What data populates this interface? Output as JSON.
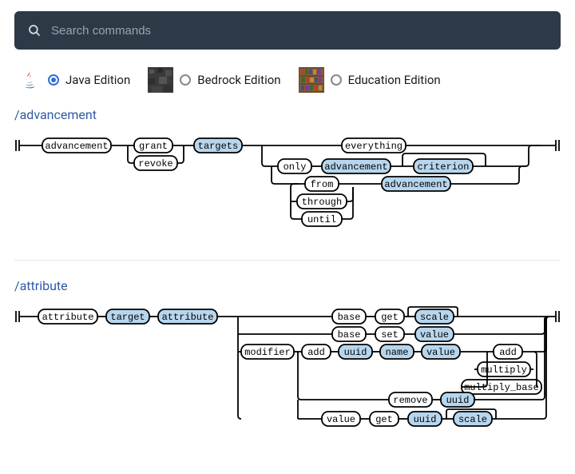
{
  "search": {
    "placeholder": "Search commands"
  },
  "editions": {
    "java": {
      "label": "Java Edition",
      "selected": true
    },
    "bedrock": {
      "label": "Bedrock Edition",
      "selected": false
    },
    "education": {
      "label": "Education Edition",
      "selected": false
    }
  },
  "sections": {
    "advancement": {
      "title": "/advancement",
      "nodes": {
        "advancement": "advancement",
        "grant": "grant",
        "revoke": "revoke",
        "targets": "targets",
        "everything": "everything",
        "only": "only",
        "from": "from",
        "through": "through",
        "until": "until",
        "advancement_arg": "advancement",
        "criterion": "criterion",
        "advancement_arg2": "advancement"
      }
    },
    "attribute": {
      "title": "/attribute",
      "nodes": {
        "attribute": "attribute",
        "target": "target",
        "attribute_arg": "attribute",
        "base1": "base",
        "get1": "get",
        "scale1": "scale",
        "base2": "base",
        "set": "set",
        "value1": "value",
        "modifier": "modifier",
        "add": "add",
        "uuid1": "uuid",
        "name": "name",
        "value2": "value",
        "add_op": "add",
        "multiply": "multiply",
        "multiply_base": "multiply_base",
        "remove": "remove",
        "uuid2": "uuid",
        "value_lit": "value",
        "get2": "get",
        "uuid3": "uuid",
        "scale2": "scale"
      }
    }
  }
}
